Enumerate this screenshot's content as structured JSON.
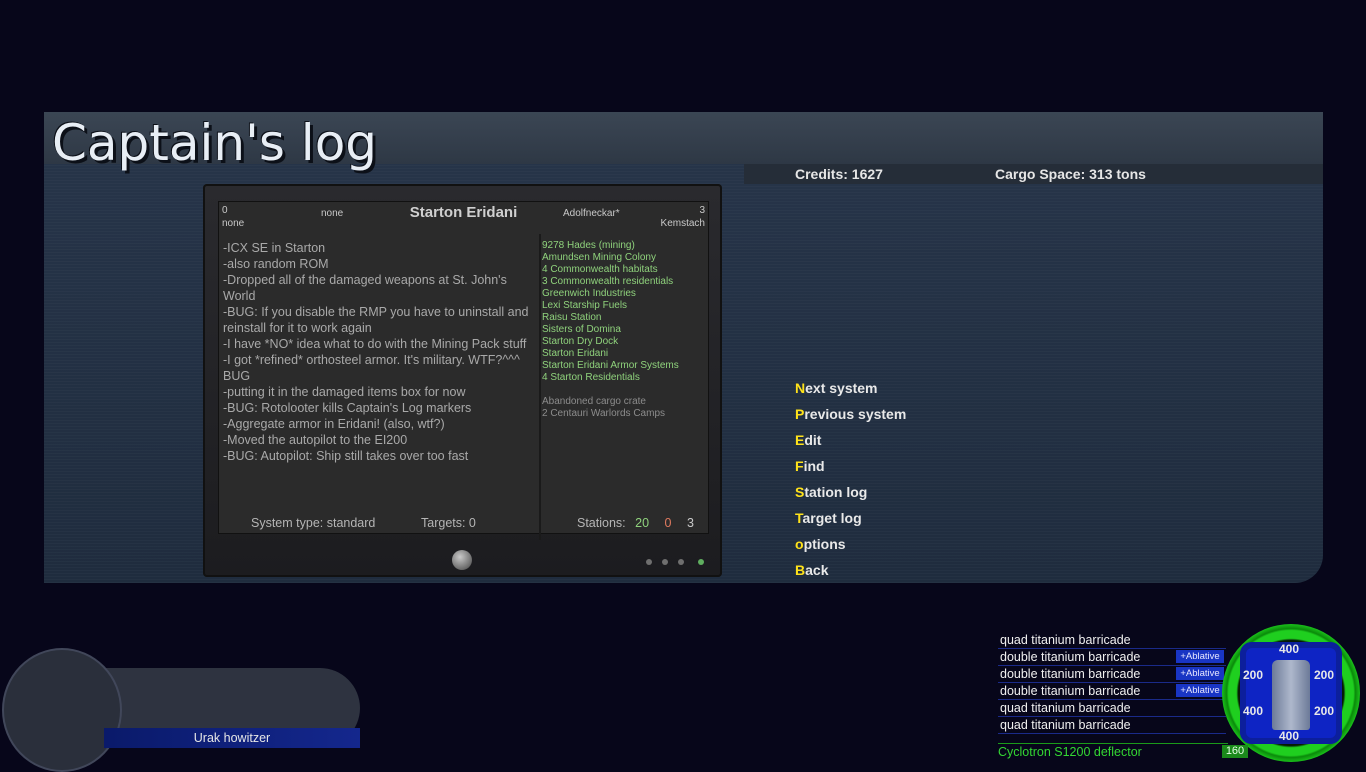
{
  "window": {
    "title": "Captain's log"
  },
  "status": {
    "credits_label": "Credits:",
    "credits_value": "1627",
    "cargo_label": "Cargo Space:",
    "cargo_value": "313 tons"
  },
  "log": {
    "header": {
      "top_left_num": "0",
      "top_left_sub": "none",
      "left_label": "none",
      "system_name": "Starton Eridani",
      "right_label": "Adolfneckar*",
      "top_right_num": "3",
      "top_right_sub": "Kemstach"
    },
    "notes": [
      "-ICX SE in Starton",
      "-also random ROM",
      "-Dropped all of the damaged weapons at St. John's World",
      "-BUG: If you disable the RMP you have to uninstall and reinstall for it to work again",
      "-I have *NO* idea what to do with the Mining Pack stuff",
      "-I got *refined* orthosteel armor. It's military. WTF?^^^ BUG",
      "-putting it in the damaged items box for now",
      "-BUG: Rotolooter kills Captain's Log markers",
      "-Aggregate armor in Eridani! (also, wtf?)",
      "-Moved the autopilot to the EI200",
      "-BUG: Autopilot: Ship still takes over too fast"
    ],
    "friendly_stations": [
      "9278 Hades (mining)",
      "Amundsen Mining Colony",
      "4 Commonwealth habitats",
      "3 Commonwealth residentials",
      "Greenwich Industries",
      "Lexi Starship Fuels",
      "Raisu Station",
      "Sisters of Domina",
      "Starton Dry Dock",
      "Starton Eridani",
      "Starton Eridani Armor Systems",
      "4 Starton Residentials"
    ],
    "other_stations": [
      "Abandoned cargo crate",
      "2 Centauri Warlords Camps"
    ],
    "footer": {
      "system_type": "System type: standard",
      "targets": "Targets: 0",
      "stations_label": "Stations:",
      "stations_friendly": "20",
      "stations_enemy": "0",
      "stations_neutral": "3"
    }
  },
  "menu": [
    {
      "hot": "N",
      "rest": "ext system"
    },
    {
      "hot": "P",
      "rest": "revious system"
    },
    {
      "hot": "E",
      "rest": "dit"
    },
    {
      "hot": "F",
      "rest": "ind"
    },
    {
      "hot": "S",
      "rest": "tation log"
    },
    {
      "hot": "T",
      "rest": "arget log"
    },
    {
      "hot": "o",
      "rest": "ptions"
    },
    {
      "hot": "B",
      "rest": "ack"
    }
  ],
  "weapon": {
    "name": "Urak howitzer"
  },
  "armor": {
    "segments": [
      {
        "name": "quad titanium barricade",
        "tag": ""
      },
      {
        "name": "double titanium barricade",
        "tag": "+Ablative"
      },
      {
        "name": "double titanium barricade",
        "tag": "+Ablative"
      },
      {
        "name": "double titanium barricade",
        "tag": "+Ablative"
      },
      {
        "name": "quad titanium barricade",
        "tag": ""
      },
      {
        "name": "quad titanium barricade",
        "tag": ""
      }
    ],
    "hp": {
      "top": "400",
      "upper_left": "200",
      "upper_right": "200",
      "lower_left": "400",
      "lower_right": "200",
      "bottom": "400"
    }
  },
  "shield": {
    "name": "Cyclotron S1200 deflector",
    "value": "160"
  },
  "colors": {
    "accent_hotkey": "#ffe21a",
    "station_friendly": "#8fd27c",
    "station_enemy": "#e07a5f",
    "shield_green": "#1fcf1f",
    "armor_blue": "#1935c4"
  }
}
